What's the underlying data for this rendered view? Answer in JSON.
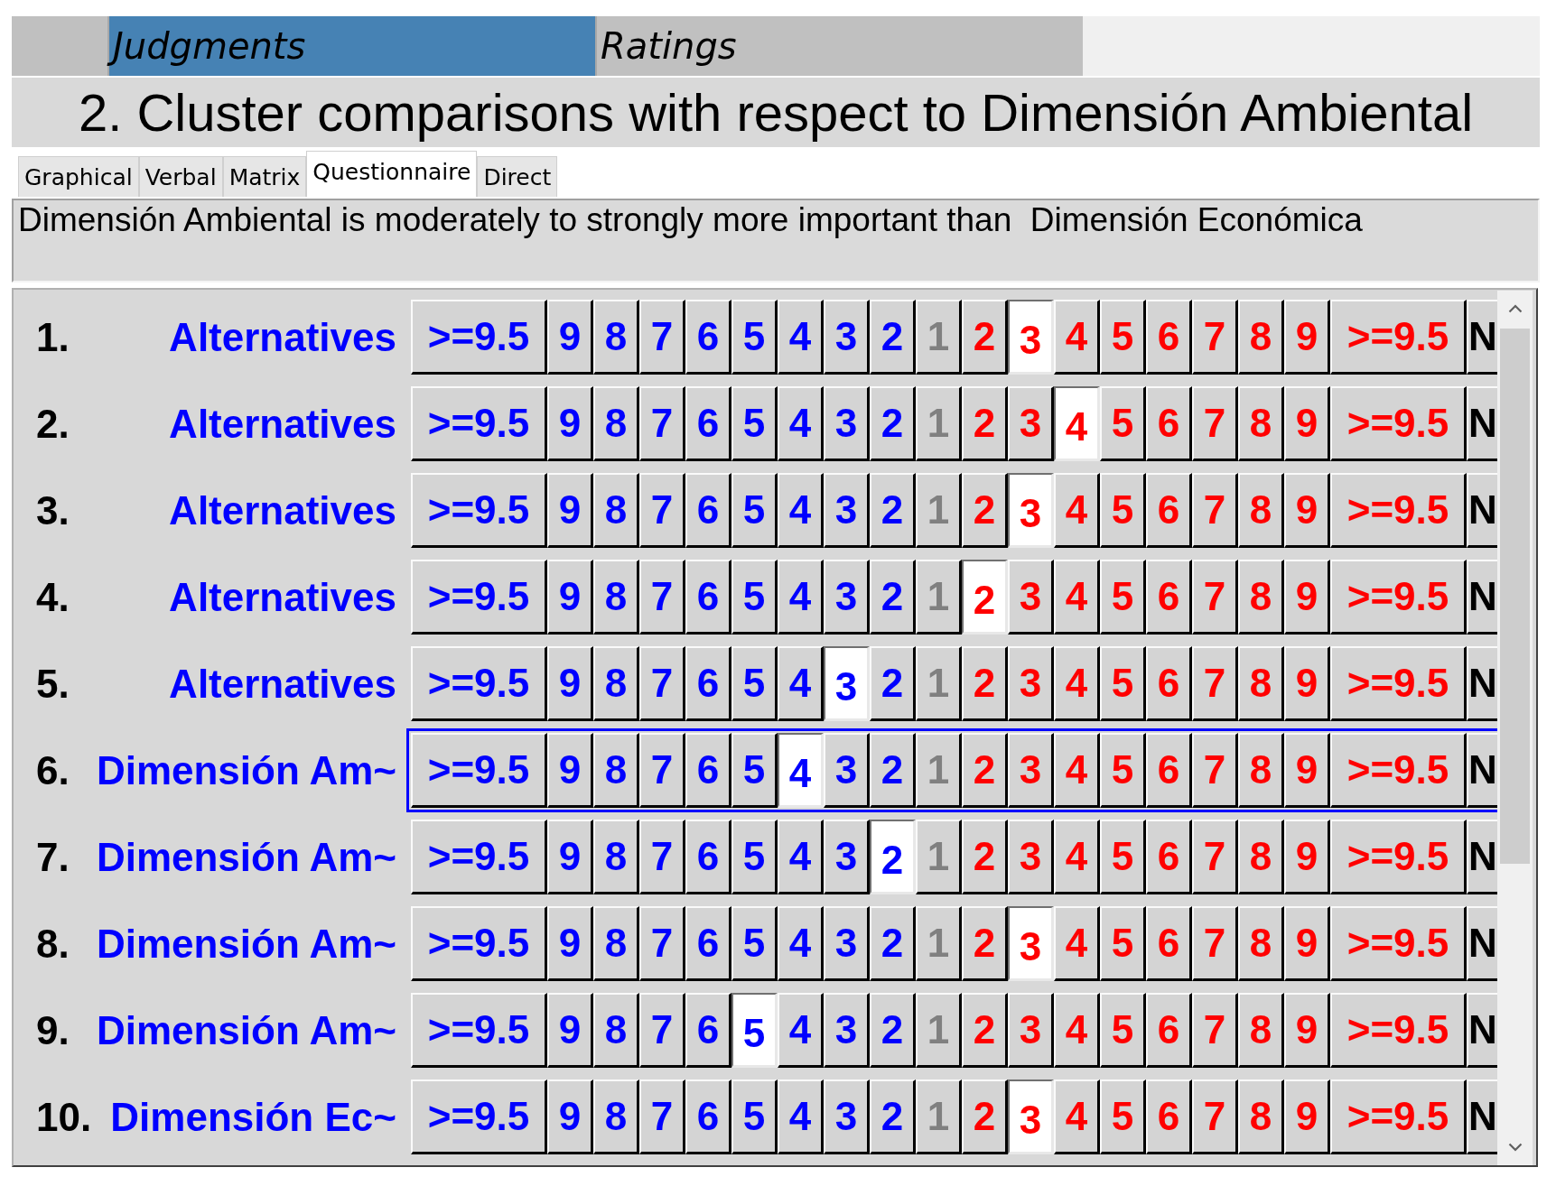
{
  "top_tabs": [
    {
      "label": "Judgments",
      "selected": true
    },
    {
      "label": "Ratings",
      "selected": false
    }
  ],
  "title": "2. Cluster comparisons with respect to Dimensión Ambiental",
  "view_tabs": [
    {
      "label": "Graphical",
      "selected": false
    },
    {
      "label": "Verbal",
      "selected": false
    },
    {
      "label": "Matrix",
      "selected": false
    },
    {
      "label": "Questionnaire",
      "selected": true
    },
    {
      "label": "Direct",
      "selected": false
    }
  ],
  "verbal_judgment": "Dimensión Ambiental is moderately to strongly more important than  Dimensión Económica",
  "comparisons": [
    {
      "number": "1.",
      "label": "Alternatives",
      "focused": false,
      "buttons": [
        {
          "label": ">=9.5",
          "color": "#0000ff",
          "selected": false
        },
        {
          "label": "9",
          "color": "#0000ff",
          "selected": false
        },
        {
          "label": "8",
          "color": "#0000ff",
          "selected": false
        },
        {
          "label": "7",
          "color": "#0000ff",
          "selected": false
        },
        {
          "label": "6",
          "color": "#0000ff",
          "selected": false
        },
        {
          "label": "5",
          "color": "#0000ff",
          "selected": false
        },
        {
          "label": "4",
          "color": "#0000ff",
          "selected": false
        },
        {
          "label": "3",
          "color": "#0000ff",
          "selected": false
        },
        {
          "label": "2",
          "color": "#0000ff",
          "selected": false
        },
        {
          "label": "1",
          "color": "#808080",
          "selected": false
        },
        {
          "label": "2",
          "color": "#ff0000",
          "selected": false
        },
        {
          "label": "3",
          "color": "#ff0000",
          "selected": true
        },
        {
          "label": "4",
          "color": "#ff0000",
          "selected": false
        },
        {
          "label": "5",
          "color": "#ff0000",
          "selected": false
        },
        {
          "label": "6",
          "color": "#ff0000",
          "selected": false
        },
        {
          "label": "7",
          "color": "#ff0000",
          "selected": false
        },
        {
          "label": "8",
          "color": "#ff0000",
          "selected": false
        },
        {
          "label": "9",
          "color": "#ff0000",
          "selected": false
        },
        {
          "label": ">=9.5",
          "color": "#ff0000",
          "selected": false
        },
        {
          "label": "N",
          "color": "#000000",
          "selected": false
        }
      ]
    },
    {
      "number": "2.",
      "label": "Alternatives",
      "focused": false,
      "buttons": [
        {
          "label": ">=9.5",
          "color": "#0000ff",
          "selected": false
        },
        {
          "label": "9",
          "color": "#0000ff",
          "selected": false
        },
        {
          "label": "8",
          "color": "#0000ff",
          "selected": false
        },
        {
          "label": "7",
          "color": "#0000ff",
          "selected": false
        },
        {
          "label": "6",
          "color": "#0000ff",
          "selected": false
        },
        {
          "label": "5",
          "color": "#0000ff",
          "selected": false
        },
        {
          "label": "4",
          "color": "#0000ff",
          "selected": false
        },
        {
          "label": "3",
          "color": "#0000ff",
          "selected": false
        },
        {
          "label": "2",
          "color": "#0000ff",
          "selected": false
        },
        {
          "label": "1",
          "color": "#808080",
          "selected": false
        },
        {
          "label": "2",
          "color": "#ff0000",
          "selected": false
        },
        {
          "label": "3",
          "color": "#ff0000",
          "selected": false
        },
        {
          "label": "4",
          "color": "#ff0000",
          "selected": true
        },
        {
          "label": "5",
          "color": "#ff0000",
          "selected": false
        },
        {
          "label": "6",
          "color": "#ff0000",
          "selected": false
        },
        {
          "label": "7",
          "color": "#ff0000",
          "selected": false
        },
        {
          "label": "8",
          "color": "#ff0000",
          "selected": false
        },
        {
          "label": "9",
          "color": "#ff0000",
          "selected": false
        },
        {
          "label": ">=9.5",
          "color": "#ff0000",
          "selected": false
        },
        {
          "label": "N",
          "color": "#000000",
          "selected": false
        }
      ]
    },
    {
      "number": "3.",
      "label": "Alternatives",
      "focused": false,
      "buttons": [
        {
          "label": ">=9.5",
          "color": "#0000ff",
          "selected": false
        },
        {
          "label": "9",
          "color": "#0000ff",
          "selected": false
        },
        {
          "label": "8",
          "color": "#0000ff",
          "selected": false
        },
        {
          "label": "7",
          "color": "#0000ff",
          "selected": false
        },
        {
          "label": "6",
          "color": "#0000ff",
          "selected": false
        },
        {
          "label": "5",
          "color": "#0000ff",
          "selected": false
        },
        {
          "label": "4",
          "color": "#0000ff",
          "selected": false
        },
        {
          "label": "3",
          "color": "#0000ff",
          "selected": false
        },
        {
          "label": "2",
          "color": "#0000ff",
          "selected": false
        },
        {
          "label": "1",
          "color": "#808080",
          "selected": false
        },
        {
          "label": "2",
          "color": "#ff0000",
          "selected": false
        },
        {
          "label": "3",
          "color": "#ff0000",
          "selected": true
        },
        {
          "label": "4",
          "color": "#ff0000",
          "selected": false
        },
        {
          "label": "5",
          "color": "#ff0000",
          "selected": false
        },
        {
          "label": "6",
          "color": "#ff0000",
          "selected": false
        },
        {
          "label": "7",
          "color": "#ff0000",
          "selected": false
        },
        {
          "label": "8",
          "color": "#ff0000",
          "selected": false
        },
        {
          "label": "9",
          "color": "#ff0000",
          "selected": false
        },
        {
          "label": ">=9.5",
          "color": "#ff0000",
          "selected": false
        },
        {
          "label": "N",
          "color": "#000000",
          "selected": false
        }
      ]
    },
    {
      "number": "4.",
      "label": "Alternatives",
      "focused": false,
      "buttons": [
        {
          "label": ">=9.5",
          "color": "#0000ff",
          "selected": false
        },
        {
          "label": "9",
          "color": "#0000ff",
          "selected": false
        },
        {
          "label": "8",
          "color": "#0000ff",
          "selected": false
        },
        {
          "label": "7",
          "color": "#0000ff",
          "selected": false
        },
        {
          "label": "6",
          "color": "#0000ff",
          "selected": false
        },
        {
          "label": "5",
          "color": "#0000ff",
          "selected": false
        },
        {
          "label": "4",
          "color": "#0000ff",
          "selected": false
        },
        {
          "label": "3",
          "color": "#0000ff",
          "selected": false
        },
        {
          "label": "2",
          "color": "#0000ff",
          "selected": false
        },
        {
          "label": "1",
          "color": "#808080",
          "selected": false
        },
        {
          "label": "2",
          "color": "#ff0000",
          "selected": true
        },
        {
          "label": "3",
          "color": "#ff0000",
          "selected": false
        },
        {
          "label": "4",
          "color": "#ff0000",
          "selected": false
        },
        {
          "label": "5",
          "color": "#ff0000",
          "selected": false
        },
        {
          "label": "6",
          "color": "#ff0000",
          "selected": false
        },
        {
          "label": "7",
          "color": "#ff0000",
          "selected": false
        },
        {
          "label": "8",
          "color": "#ff0000",
          "selected": false
        },
        {
          "label": "9",
          "color": "#ff0000",
          "selected": false
        },
        {
          "label": ">=9.5",
          "color": "#ff0000",
          "selected": false
        },
        {
          "label": "N",
          "color": "#000000",
          "selected": false
        }
      ]
    },
    {
      "number": "5.",
      "label": "Alternatives",
      "focused": false,
      "buttons": [
        {
          "label": ">=9.5",
          "color": "#0000ff",
          "selected": false
        },
        {
          "label": "9",
          "color": "#0000ff",
          "selected": false
        },
        {
          "label": "8",
          "color": "#0000ff",
          "selected": false
        },
        {
          "label": "7",
          "color": "#0000ff",
          "selected": false
        },
        {
          "label": "6",
          "color": "#0000ff",
          "selected": false
        },
        {
          "label": "5",
          "color": "#0000ff",
          "selected": false
        },
        {
          "label": "4",
          "color": "#0000ff",
          "selected": false
        },
        {
          "label": "3",
          "color": "#0000ff",
          "selected": true
        },
        {
          "label": "2",
          "color": "#0000ff",
          "selected": false
        },
        {
          "label": "1",
          "color": "#808080",
          "selected": false
        },
        {
          "label": "2",
          "color": "#ff0000",
          "selected": false
        },
        {
          "label": "3",
          "color": "#ff0000",
          "selected": false
        },
        {
          "label": "4",
          "color": "#ff0000",
          "selected": false
        },
        {
          "label": "5",
          "color": "#ff0000",
          "selected": false
        },
        {
          "label": "6",
          "color": "#ff0000",
          "selected": false
        },
        {
          "label": "7",
          "color": "#ff0000",
          "selected": false
        },
        {
          "label": "8",
          "color": "#ff0000",
          "selected": false
        },
        {
          "label": "9",
          "color": "#ff0000",
          "selected": false
        },
        {
          "label": ">=9.5",
          "color": "#ff0000",
          "selected": false
        },
        {
          "label": "N",
          "color": "#000000",
          "selected": false
        }
      ]
    },
    {
      "number": "6.",
      "label": "Dimensión Am~",
      "focused": true,
      "buttons": [
        {
          "label": ">=9.5",
          "color": "#0000ff",
          "selected": false
        },
        {
          "label": "9",
          "color": "#0000ff",
          "selected": false
        },
        {
          "label": "8",
          "color": "#0000ff",
          "selected": false
        },
        {
          "label": "7",
          "color": "#0000ff",
          "selected": false
        },
        {
          "label": "6",
          "color": "#0000ff",
          "selected": false
        },
        {
          "label": "5",
          "color": "#0000ff",
          "selected": false
        },
        {
          "label": "4",
          "color": "#0000ff",
          "selected": true
        },
        {
          "label": "3",
          "color": "#0000ff",
          "selected": false
        },
        {
          "label": "2",
          "color": "#0000ff",
          "selected": false
        },
        {
          "label": "1",
          "color": "#808080",
          "selected": false
        },
        {
          "label": "2",
          "color": "#ff0000",
          "selected": false
        },
        {
          "label": "3",
          "color": "#ff0000",
          "selected": false
        },
        {
          "label": "4",
          "color": "#ff0000",
          "selected": false
        },
        {
          "label": "5",
          "color": "#ff0000",
          "selected": false
        },
        {
          "label": "6",
          "color": "#ff0000",
          "selected": false
        },
        {
          "label": "7",
          "color": "#ff0000",
          "selected": false
        },
        {
          "label": "8",
          "color": "#ff0000",
          "selected": false
        },
        {
          "label": "9",
          "color": "#ff0000",
          "selected": false
        },
        {
          "label": ">=9.5",
          "color": "#ff0000",
          "selected": false
        },
        {
          "label": "N",
          "color": "#000000",
          "selected": false
        }
      ]
    },
    {
      "number": "7.",
      "label": "Dimensión Am~",
      "focused": false,
      "buttons": [
        {
          "label": ">=9.5",
          "color": "#0000ff",
          "selected": false
        },
        {
          "label": "9",
          "color": "#0000ff",
          "selected": false
        },
        {
          "label": "8",
          "color": "#0000ff",
          "selected": false
        },
        {
          "label": "7",
          "color": "#0000ff",
          "selected": false
        },
        {
          "label": "6",
          "color": "#0000ff",
          "selected": false
        },
        {
          "label": "5",
          "color": "#0000ff",
          "selected": false
        },
        {
          "label": "4",
          "color": "#0000ff",
          "selected": false
        },
        {
          "label": "3",
          "color": "#0000ff",
          "selected": false
        },
        {
          "label": "2",
          "color": "#0000ff",
          "selected": true
        },
        {
          "label": "1",
          "color": "#808080",
          "selected": false
        },
        {
          "label": "2",
          "color": "#ff0000",
          "selected": false
        },
        {
          "label": "3",
          "color": "#ff0000",
          "selected": false
        },
        {
          "label": "4",
          "color": "#ff0000",
          "selected": false
        },
        {
          "label": "5",
          "color": "#ff0000",
          "selected": false
        },
        {
          "label": "6",
          "color": "#ff0000",
          "selected": false
        },
        {
          "label": "7",
          "color": "#ff0000",
          "selected": false
        },
        {
          "label": "8",
          "color": "#ff0000",
          "selected": false
        },
        {
          "label": "9",
          "color": "#ff0000",
          "selected": false
        },
        {
          "label": ">=9.5",
          "color": "#ff0000",
          "selected": false
        },
        {
          "label": "N",
          "color": "#000000",
          "selected": false
        }
      ]
    },
    {
      "number": "8.",
      "label": "Dimensión Am~",
      "focused": false,
      "buttons": [
        {
          "label": ">=9.5",
          "color": "#0000ff",
          "selected": false
        },
        {
          "label": "9",
          "color": "#0000ff",
          "selected": false
        },
        {
          "label": "8",
          "color": "#0000ff",
          "selected": false
        },
        {
          "label": "7",
          "color": "#0000ff",
          "selected": false
        },
        {
          "label": "6",
          "color": "#0000ff",
          "selected": false
        },
        {
          "label": "5",
          "color": "#0000ff",
          "selected": false
        },
        {
          "label": "4",
          "color": "#0000ff",
          "selected": false
        },
        {
          "label": "3",
          "color": "#0000ff",
          "selected": false
        },
        {
          "label": "2",
          "color": "#0000ff",
          "selected": false
        },
        {
          "label": "1",
          "color": "#808080",
          "selected": false
        },
        {
          "label": "2",
          "color": "#ff0000",
          "selected": false
        },
        {
          "label": "3",
          "color": "#ff0000",
          "selected": true
        },
        {
          "label": "4",
          "color": "#ff0000",
          "selected": false
        },
        {
          "label": "5",
          "color": "#ff0000",
          "selected": false
        },
        {
          "label": "6",
          "color": "#ff0000",
          "selected": false
        },
        {
          "label": "7",
          "color": "#ff0000",
          "selected": false
        },
        {
          "label": "8",
          "color": "#ff0000",
          "selected": false
        },
        {
          "label": "9",
          "color": "#ff0000",
          "selected": false
        },
        {
          "label": ">=9.5",
          "color": "#ff0000",
          "selected": false
        },
        {
          "label": "N",
          "color": "#000000",
          "selected": false
        }
      ]
    },
    {
      "number": "9.",
      "label": "Dimensión Am~",
      "focused": false,
      "buttons": [
        {
          "label": ">=9.5",
          "color": "#0000ff",
          "selected": false
        },
        {
          "label": "9",
          "color": "#0000ff",
          "selected": false
        },
        {
          "label": "8",
          "color": "#0000ff",
          "selected": false
        },
        {
          "label": "7",
          "color": "#0000ff",
          "selected": false
        },
        {
          "label": "6",
          "color": "#0000ff",
          "selected": false
        },
        {
          "label": "5",
          "color": "#0000ff",
          "selected": true
        },
        {
          "label": "4",
          "color": "#0000ff",
          "selected": false
        },
        {
          "label": "3",
          "color": "#0000ff",
          "selected": false
        },
        {
          "label": "2",
          "color": "#0000ff",
          "selected": false
        },
        {
          "label": "1",
          "color": "#808080",
          "selected": false
        },
        {
          "label": "2",
          "color": "#ff0000",
          "selected": false
        },
        {
          "label": "3",
          "color": "#ff0000",
          "selected": false
        },
        {
          "label": "4",
          "color": "#ff0000",
          "selected": false
        },
        {
          "label": "5",
          "color": "#ff0000",
          "selected": false
        },
        {
          "label": "6",
          "color": "#ff0000",
          "selected": false
        },
        {
          "label": "7",
          "color": "#ff0000",
          "selected": false
        },
        {
          "label": "8",
          "color": "#ff0000",
          "selected": false
        },
        {
          "label": "9",
          "color": "#ff0000",
          "selected": false
        },
        {
          "label": ">=9.5",
          "color": "#ff0000",
          "selected": false
        },
        {
          "label": "N",
          "color": "#000000",
          "selected": false
        }
      ]
    },
    {
      "number": "10.",
      "label": "Dimensión Ec~",
      "focused": false,
      "buttons": [
        {
          "label": ">=9.5",
          "color": "#0000ff",
          "selected": false
        },
        {
          "label": "9",
          "color": "#0000ff",
          "selected": false
        },
        {
          "label": "8",
          "color": "#0000ff",
          "selected": false
        },
        {
          "label": "7",
          "color": "#0000ff",
          "selected": false
        },
        {
          "label": "6",
          "color": "#0000ff",
          "selected": false
        },
        {
          "label": "5",
          "color": "#0000ff",
          "selected": false
        },
        {
          "label": "4",
          "color": "#0000ff",
          "selected": false
        },
        {
          "label": "3",
          "color": "#0000ff",
          "selected": false
        },
        {
          "label": "2",
          "color": "#0000ff",
          "selected": false
        },
        {
          "label": "1",
          "color": "#808080",
          "selected": false
        },
        {
          "label": "2",
          "color": "#ff0000",
          "selected": false
        },
        {
          "label": "3",
          "color": "#ff0000",
          "selected": true
        },
        {
          "label": "4",
          "color": "#ff0000",
          "selected": false
        },
        {
          "label": "5",
          "color": "#ff0000",
          "selected": false
        },
        {
          "label": "6",
          "color": "#ff0000",
          "selected": false
        },
        {
          "label": "7",
          "color": "#ff0000",
          "selected": false
        },
        {
          "label": "8",
          "color": "#ff0000",
          "selected": false
        },
        {
          "label": "9",
          "color": "#ff0000",
          "selected": false
        },
        {
          "label": ">=9.5",
          "color": "#ff0000",
          "selected": false
        },
        {
          "label": "N",
          "color": "#000000",
          "selected": false
        }
      ]
    }
  ]
}
